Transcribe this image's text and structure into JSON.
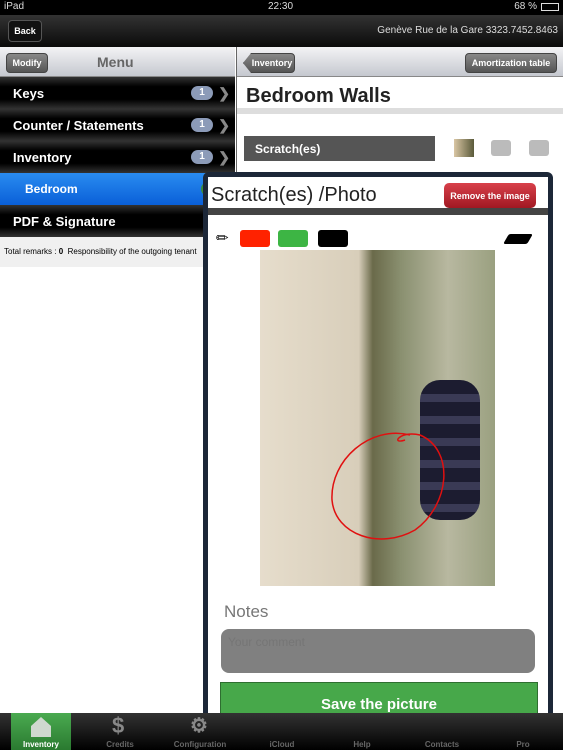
{
  "status": {
    "device": "iPad",
    "time": "22:30",
    "battery": "68 %"
  },
  "nav": {
    "back": "Back",
    "location": "Genève Rue de la Gare  3323.7452.8463"
  },
  "sidebar": {
    "modify": "Modify",
    "title": "Menu",
    "items": [
      {
        "label": "Keys",
        "badge": "1"
      },
      {
        "label": "Counter / Statements",
        "badge": "1"
      },
      {
        "label": "Inventory",
        "badge": "1"
      },
      {
        "label": "Bedroom",
        "selected": true
      },
      {
        "label": "PDF & Signature"
      }
    ],
    "remarks_label": "Total remarks : ",
    "remarks_count": "0",
    "remarks_text": "Responsibility of the outgoing tenant"
  },
  "main": {
    "back": "Inventory",
    "amortization": "Amortization table",
    "title": "Bedroom  Walls",
    "section": "Scratch(es)"
  },
  "popover": {
    "title": "Scratch(es) /Photo",
    "remove": "Remove the image",
    "colors": [
      "#ff2200",
      "#3db544",
      "#000000"
    ],
    "notes_label": "Notes",
    "comment_placeholder": "Your comment",
    "save": "Save the picture"
  },
  "tabs": [
    {
      "label": "Inventory",
      "active": true
    },
    {
      "label": "Credits"
    },
    {
      "label": "Configuration"
    },
    {
      "label": "iCloud"
    },
    {
      "label": "Help"
    },
    {
      "label": "Contacts"
    },
    {
      "label": "Pro"
    }
  ]
}
